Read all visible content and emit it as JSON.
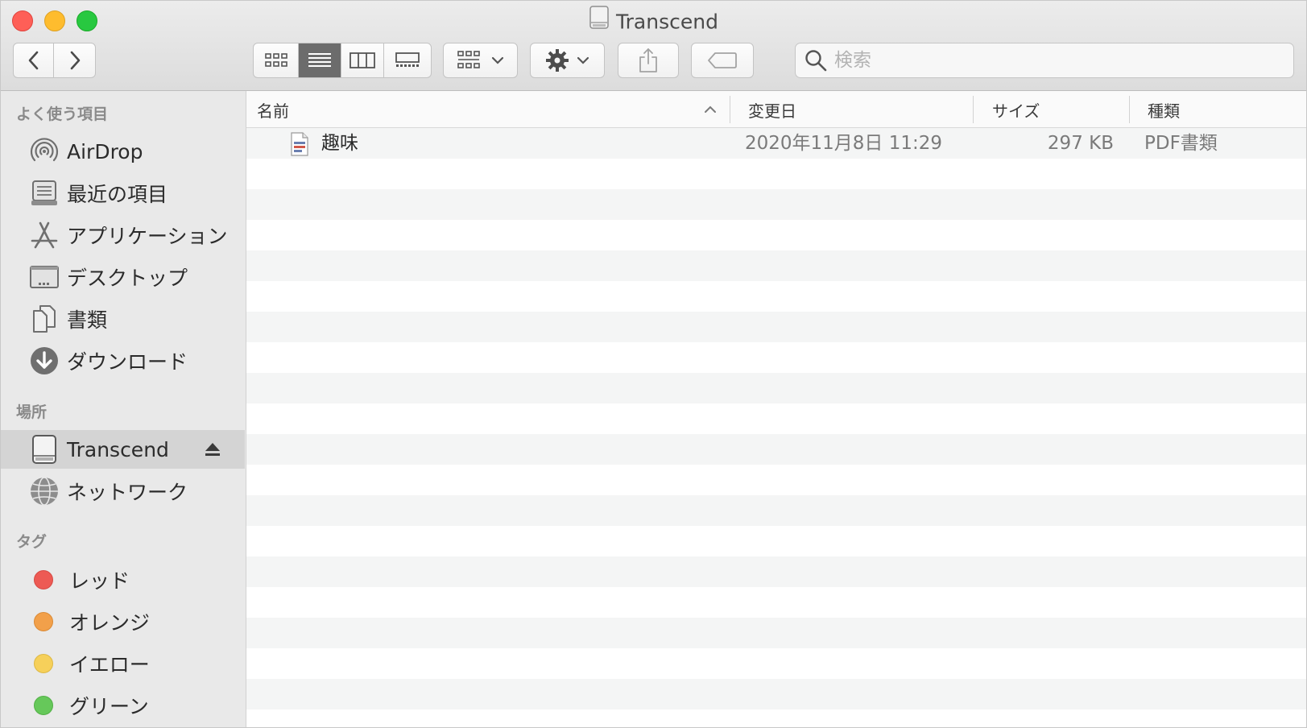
{
  "window": {
    "title": "Transcend"
  },
  "toolbar": {
    "back_icon": "chevron-left-icon",
    "forward_icon": "chevron-right-icon",
    "view_modes": [
      "icon-view-icon",
      "list-view-icon",
      "column-view-icon",
      "gallery-view-icon"
    ],
    "active_view": "list",
    "search_placeholder": "検索"
  },
  "sidebar": {
    "favorites_heading": "よく使う項目",
    "favorites": [
      {
        "label": "AirDrop",
        "icon": "airdrop-icon"
      },
      {
        "label": "最近の項目",
        "icon": "recents-icon"
      },
      {
        "label": "アプリケーション",
        "icon": "applications-icon"
      },
      {
        "label": "デスクトップ",
        "icon": "desktop-icon"
      },
      {
        "label": "書類",
        "icon": "documents-icon"
      },
      {
        "label": "ダウンロード",
        "icon": "downloads-icon"
      }
    ],
    "locations_heading": "場所",
    "locations": [
      {
        "label": "Transcend",
        "icon": "external-disk-icon",
        "selected": true
      },
      {
        "label": "ネットワーク",
        "icon": "network-icon"
      }
    ],
    "tags_heading": "タグ",
    "tags": [
      {
        "label": "レッド",
        "color": "#ed5a54"
      },
      {
        "label": "オレンジ",
        "color": "#f2a04a"
      },
      {
        "label": "イエロー",
        "color": "#f6d05a"
      },
      {
        "label": "グリーン",
        "color": "#66c85a"
      }
    ]
  },
  "file_list": {
    "columns": {
      "name": "名前",
      "modified": "変更日",
      "size": "サイズ",
      "kind": "種類"
    },
    "rows": [
      {
        "name": "趣味",
        "modified": "2020年11月8日 11:29",
        "size": "297 KB",
        "kind": "PDF書類"
      }
    ]
  }
}
